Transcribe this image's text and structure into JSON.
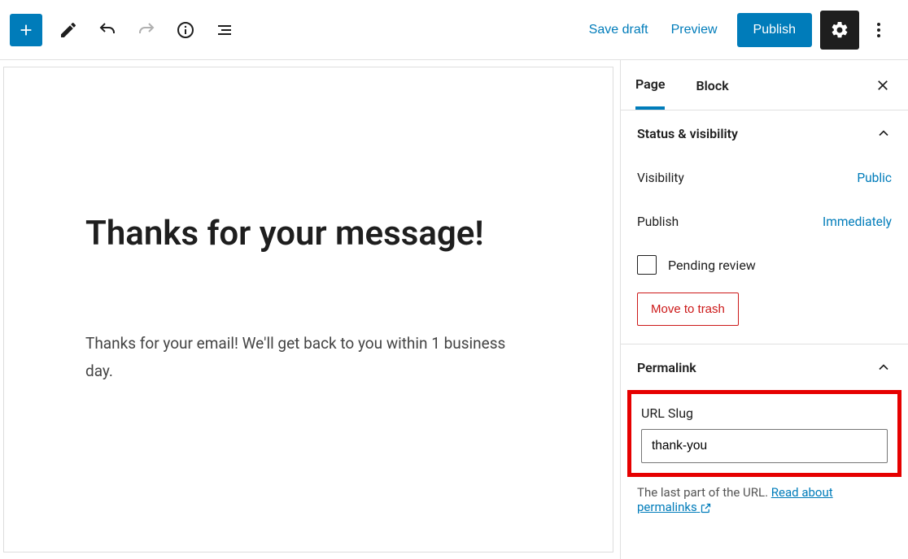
{
  "topbar": {
    "save_draft": "Save draft",
    "preview": "Preview",
    "publish": "Publish"
  },
  "editor": {
    "title": "Thanks for your message!",
    "body": "Thanks for your email! We'll get back to you within 1 business day."
  },
  "sidebar": {
    "tabs": {
      "page": "Page",
      "block": "Block"
    },
    "status": {
      "title": "Status & visibility",
      "visibility_label": "Visibility",
      "visibility_value": "Public",
      "publish_label": "Publish",
      "publish_value": "Immediately",
      "pending_label": "Pending review",
      "trash": "Move to trash"
    },
    "permalink": {
      "title": "Permalink",
      "slug_label": "URL Slug",
      "slug_value": "thank-you",
      "helper_prefix": "The last part of the URL. ",
      "helper_link": "Read about permalinks"
    }
  }
}
